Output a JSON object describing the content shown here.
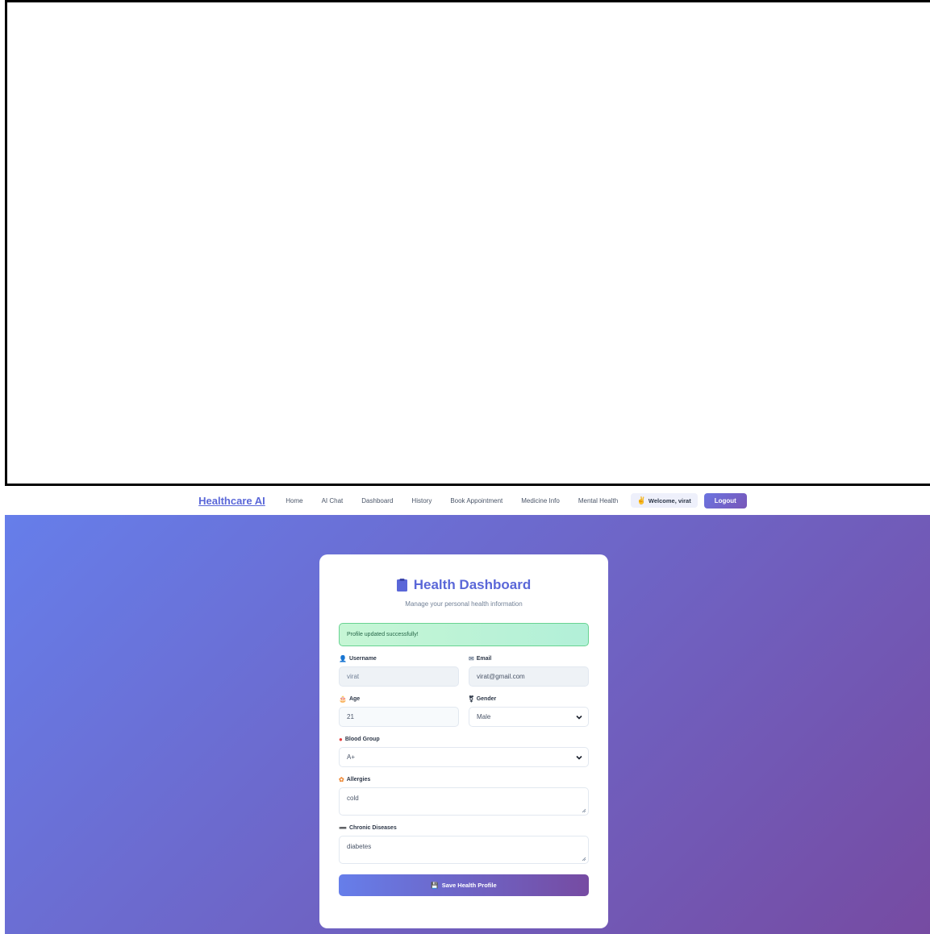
{
  "navbar": {
    "brand": "Healthcare AI",
    "links": [
      "Home",
      "AI Chat",
      "Dashboard",
      "History",
      "Book Appointment",
      "Medicine Info",
      "Mental Health"
    ],
    "welcome": "Welcome, virat",
    "logout_label": "Logout"
  },
  "card": {
    "title": "Health Dashboard",
    "subtitle": "Manage your personal health information",
    "alert": "Profile updated successfully!",
    "fields": {
      "username_label": "Username",
      "username_value": "virat",
      "email_label": "Email",
      "email_value": "virat@gmail.com",
      "age_label": "Age",
      "age_value": "21",
      "gender_label": "Gender",
      "gender_value": "Male",
      "blood_label": "Blood Group",
      "blood_value": "A+",
      "allergies_label": "Allergies",
      "allergies_value": "cold",
      "chronic_label": "Chronic Diseases",
      "chronic_value": "diabetes"
    },
    "save_label": "Save Health Profile"
  },
  "colors": {
    "brand": "#5a67d8",
    "gradient_start": "#667eea",
    "gradient_end": "#764ba2",
    "success_bg": "#c6f6d5"
  }
}
